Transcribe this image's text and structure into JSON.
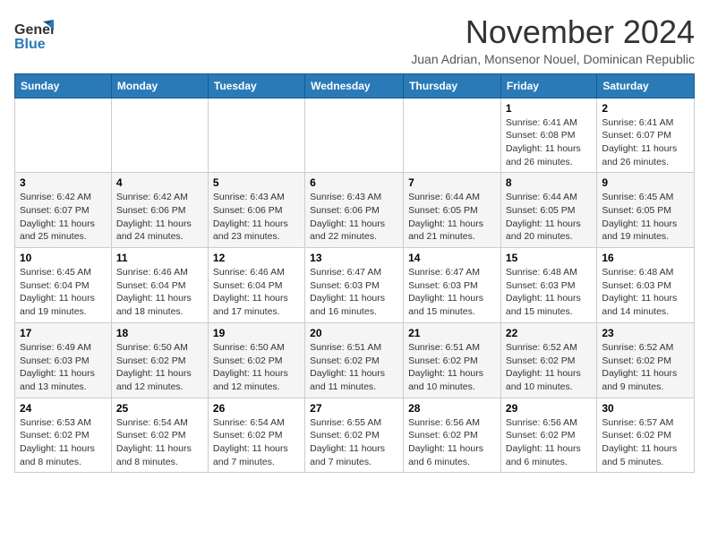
{
  "header": {
    "logo_general": "General",
    "logo_blue": "Blue",
    "month_title": "November 2024",
    "subtitle": "Juan Adrian, Monsenor Nouel, Dominican Republic"
  },
  "weekdays": [
    "Sunday",
    "Monday",
    "Tuesday",
    "Wednesday",
    "Thursday",
    "Friday",
    "Saturday"
  ],
  "weeks": [
    [
      {
        "day": "",
        "info": ""
      },
      {
        "day": "",
        "info": ""
      },
      {
        "day": "",
        "info": ""
      },
      {
        "day": "",
        "info": ""
      },
      {
        "day": "",
        "info": ""
      },
      {
        "day": "1",
        "info": "Sunrise: 6:41 AM\nSunset: 6:08 PM\nDaylight: 11 hours and 26 minutes."
      },
      {
        "day": "2",
        "info": "Sunrise: 6:41 AM\nSunset: 6:07 PM\nDaylight: 11 hours and 26 minutes."
      }
    ],
    [
      {
        "day": "3",
        "info": "Sunrise: 6:42 AM\nSunset: 6:07 PM\nDaylight: 11 hours and 25 minutes."
      },
      {
        "day": "4",
        "info": "Sunrise: 6:42 AM\nSunset: 6:06 PM\nDaylight: 11 hours and 24 minutes."
      },
      {
        "day": "5",
        "info": "Sunrise: 6:43 AM\nSunset: 6:06 PM\nDaylight: 11 hours and 23 minutes."
      },
      {
        "day": "6",
        "info": "Sunrise: 6:43 AM\nSunset: 6:06 PM\nDaylight: 11 hours and 22 minutes."
      },
      {
        "day": "7",
        "info": "Sunrise: 6:44 AM\nSunset: 6:05 PM\nDaylight: 11 hours and 21 minutes."
      },
      {
        "day": "8",
        "info": "Sunrise: 6:44 AM\nSunset: 6:05 PM\nDaylight: 11 hours and 20 minutes."
      },
      {
        "day": "9",
        "info": "Sunrise: 6:45 AM\nSunset: 6:05 PM\nDaylight: 11 hours and 19 minutes."
      }
    ],
    [
      {
        "day": "10",
        "info": "Sunrise: 6:45 AM\nSunset: 6:04 PM\nDaylight: 11 hours and 19 minutes."
      },
      {
        "day": "11",
        "info": "Sunrise: 6:46 AM\nSunset: 6:04 PM\nDaylight: 11 hours and 18 minutes."
      },
      {
        "day": "12",
        "info": "Sunrise: 6:46 AM\nSunset: 6:04 PM\nDaylight: 11 hours and 17 minutes."
      },
      {
        "day": "13",
        "info": "Sunrise: 6:47 AM\nSunset: 6:03 PM\nDaylight: 11 hours and 16 minutes."
      },
      {
        "day": "14",
        "info": "Sunrise: 6:47 AM\nSunset: 6:03 PM\nDaylight: 11 hours and 15 minutes."
      },
      {
        "day": "15",
        "info": "Sunrise: 6:48 AM\nSunset: 6:03 PM\nDaylight: 11 hours and 15 minutes."
      },
      {
        "day": "16",
        "info": "Sunrise: 6:48 AM\nSunset: 6:03 PM\nDaylight: 11 hours and 14 minutes."
      }
    ],
    [
      {
        "day": "17",
        "info": "Sunrise: 6:49 AM\nSunset: 6:03 PM\nDaylight: 11 hours and 13 minutes."
      },
      {
        "day": "18",
        "info": "Sunrise: 6:50 AM\nSunset: 6:02 PM\nDaylight: 11 hours and 12 minutes."
      },
      {
        "day": "19",
        "info": "Sunrise: 6:50 AM\nSunset: 6:02 PM\nDaylight: 11 hours and 12 minutes."
      },
      {
        "day": "20",
        "info": "Sunrise: 6:51 AM\nSunset: 6:02 PM\nDaylight: 11 hours and 11 minutes."
      },
      {
        "day": "21",
        "info": "Sunrise: 6:51 AM\nSunset: 6:02 PM\nDaylight: 11 hours and 10 minutes."
      },
      {
        "day": "22",
        "info": "Sunrise: 6:52 AM\nSunset: 6:02 PM\nDaylight: 11 hours and 10 minutes."
      },
      {
        "day": "23",
        "info": "Sunrise: 6:52 AM\nSunset: 6:02 PM\nDaylight: 11 hours and 9 minutes."
      }
    ],
    [
      {
        "day": "24",
        "info": "Sunrise: 6:53 AM\nSunset: 6:02 PM\nDaylight: 11 hours and 8 minutes."
      },
      {
        "day": "25",
        "info": "Sunrise: 6:54 AM\nSunset: 6:02 PM\nDaylight: 11 hours and 8 minutes."
      },
      {
        "day": "26",
        "info": "Sunrise: 6:54 AM\nSunset: 6:02 PM\nDaylight: 11 hours and 7 minutes."
      },
      {
        "day": "27",
        "info": "Sunrise: 6:55 AM\nSunset: 6:02 PM\nDaylight: 11 hours and 7 minutes."
      },
      {
        "day": "28",
        "info": "Sunrise: 6:56 AM\nSunset: 6:02 PM\nDaylight: 11 hours and 6 minutes."
      },
      {
        "day": "29",
        "info": "Sunrise: 6:56 AM\nSunset: 6:02 PM\nDaylight: 11 hours and 6 minutes."
      },
      {
        "day": "30",
        "info": "Sunrise: 6:57 AM\nSunset: 6:02 PM\nDaylight: 11 hours and 5 minutes."
      }
    ]
  ]
}
